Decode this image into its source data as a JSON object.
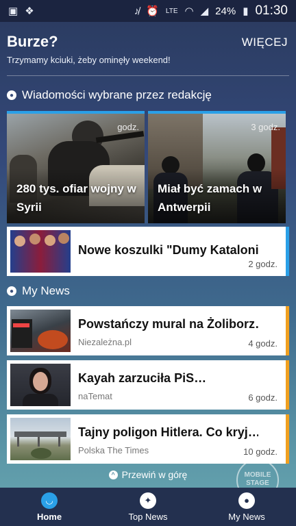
{
  "statusbar": {
    "left_icons": [
      "image-icon",
      "dropbox-icon"
    ],
    "right_icons": [
      "mute-icon",
      "alarm-icon",
      "lte-icon",
      "wifi-icon",
      "signal-icon"
    ],
    "battery": "24%",
    "time": "01:30"
  },
  "header": {
    "title": "Burze?",
    "subtitle": "Trzymamy kciuki, żeby ominęły weekend!",
    "more": "WIĘCEJ"
  },
  "editors": {
    "title": "Wiadomości wybrane przez redakcję",
    "hero": [
      {
        "title": "280 tys. ofiar wojny w Syrii",
        "time": "godz."
      },
      {
        "title": "Miał być zamach w Antwerpii",
        "time": "3 godz."
      }
    ],
    "card": {
      "title": "Nowe koszulki \"Dumy Katalonii\"",
      "time": "2 godz."
    }
  },
  "mynews": {
    "title": "My News",
    "items": [
      {
        "title": "Powstańczy mural na Żoliborz…",
        "source": "Niezależna.pl",
        "time": "4 godz."
      },
      {
        "title": "Kayah zarzuciła PiS…",
        "source": "naTemat",
        "time": "6 godz."
      },
      {
        "title": "Tajny poligon Hitlera. Co kryj…",
        "source": "Polska The Times",
        "time": "10 godz."
      }
    ]
  },
  "scrolltop": "Przewiń w górę",
  "watermark": "MOBILE STAGE",
  "nav": [
    {
      "label": "Home",
      "active": true
    },
    {
      "label": "Top News",
      "active": false
    },
    {
      "label": "My News",
      "active": false
    }
  ],
  "colors": {
    "accent_blue": "#2aa0e8",
    "accent_orange": "#f0a020",
    "nav_bg": "#23304f"
  }
}
